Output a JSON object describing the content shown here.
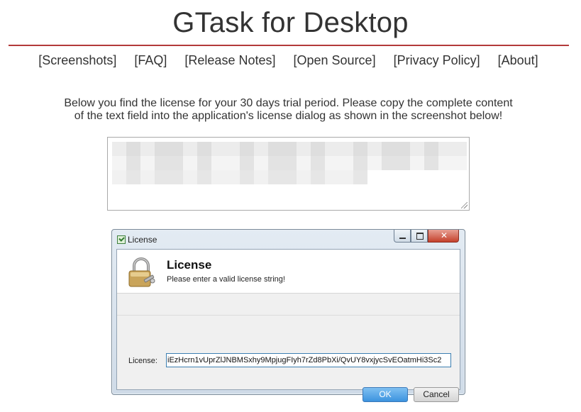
{
  "site": {
    "title": "GTask for Desktop",
    "nav": [
      "[Screenshots]",
      "[FAQ]",
      "[Release Notes]",
      "[Open Source]",
      "[Privacy Policy]",
      "[About]"
    ],
    "intro_line1": "Below you find the license for your 30 days trial period. Please copy the complete content",
    "intro_line2": "of the text field into the application's license dialog as shown in the screenshot below!"
  },
  "license_field": {
    "state": "pixelated/obscured license text"
  },
  "dialog": {
    "window_title": "License",
    "heading": "License",
    "subheading": "Please enter a valid license string!",
    "license_label": "License:",
    "license_value": "iEzHcrn1vUprZlJNBMSxhy9MpjugFIyh7rZd8PbXi/QvUY8vxjycSvEOatmHi3Sc2",
    "ok_label": "OK",
    "cancel_label": "Cancel"
  },
  "colors": {
    "title_rule": "#b33a3a",
    "ok_button": "#3c93df"
  }
}
